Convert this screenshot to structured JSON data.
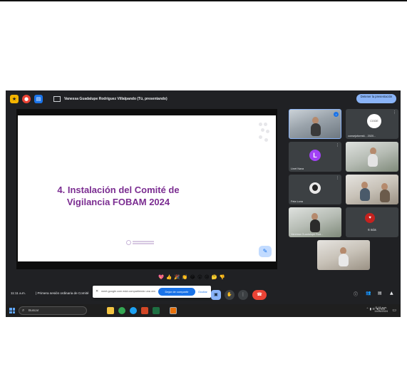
{
  "meet_top": {
    "presenter_title": "Vanessa Guadalupe Rodríguez Villalpando (Tú, presentando)",
    "stop_button": "Detener la presentación"
  },
  "slide": {
    "title_line1": "4. Instalación del Comité de",
    "title_line2": "Vigilancia FOBAM 2024"
  },
  "participants": [
    {
      "name": "",
      "kind": "camera"
    },
    {
      "name": "consejoforesti... 2020...",
      "kind": "logo",
      "logo_text": "COCIE"
    },
    {
      "name": "Linet Nava",
      "kind": "avatar",
      "initial": "L",
      "color": "#a142f4"
    },
    {
      "name": "",
      "kind": "camera"
    },
    {
      "name": "Fela Luna",
      "kind": "photo"
    },
    {
      "name": "",
      "kind": "camera"
    },
    {
      "name": "Vanessa Guadalupe Rod...",
      "kind": "camera"
    },
    {
      "name": "6 más",
      "kind": "more"
    },
    {
      "name": "",
      "kind": "camera"
    }
  ],
  "reactions": [
    "💖",
    "👍",
    "🎉",
    "👏",
    "😂",
    "😮",
    "😢",
    "🤔",
    "👎"
  ],
  "bottom_bar": {
    "time": "11:11 a.m.",
    "separator": "|",
    "meeting_name": "Primera sesión ordinaria de Comité",
    "toast_text": "meet.google.com está compartiendo una ventana",
    "toast_primary": "Dejar de compartir",
    "toast_secondary": "Ocultar"
  },
  "taskbar": {
    "search_placeholder": "Buscar",
    "tray_text": "ES",
    "time": "11:11 a.m.",
    "date": "11/06/2024"
  },
  "colors": {
    "meet_bg": "#202124",
    "accent": "#8ab4f8",
    "slide_title": "#7b2d91",
    "end_call": "#ea4335"
  }
}
